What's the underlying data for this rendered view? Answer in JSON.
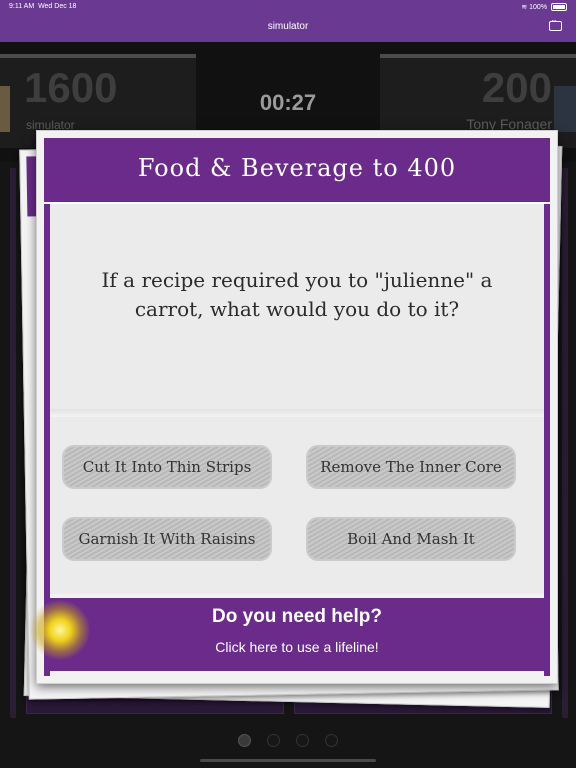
{
  "status_bar": {
    "time": "9:11 AM",
    "date": "Wed Dec 18",
    "battery": "100%"
  },
  "nav": {
    "title": "simulator"
  },
  "scoreboard": {
    "left_score": "1600",
    "left_name": "simulator",
    "timer": "00:27",
    "right_score": "200",
    "right_name": "Tony Fonager"
  },
  "card": {
    "title": "Food & Beverage to 400",
    "question": "If a recipe required you to \"julienne\" a carrot, what would you do to it?",
    "answers": [
      "Cut It Into Thin Strips",
      "Remove The Inner Core",
      "Garnish It With Raisins",
      "Boil And Mash It"
    ],
    "help_title": "Do you need help?",
    "help_subtitle": "Click here to use a lifeline!"
  },
  "colors": {
    "nav_purple": "#6a3a92",
    "card_purple": "#6a2b8a",
    "background": "#151515"
  },
  "icons": {
    "chat": "chat-bubble-icon",
    "wifi": "wifi-icon",
    "battery": "battery-icon"
  }
}
